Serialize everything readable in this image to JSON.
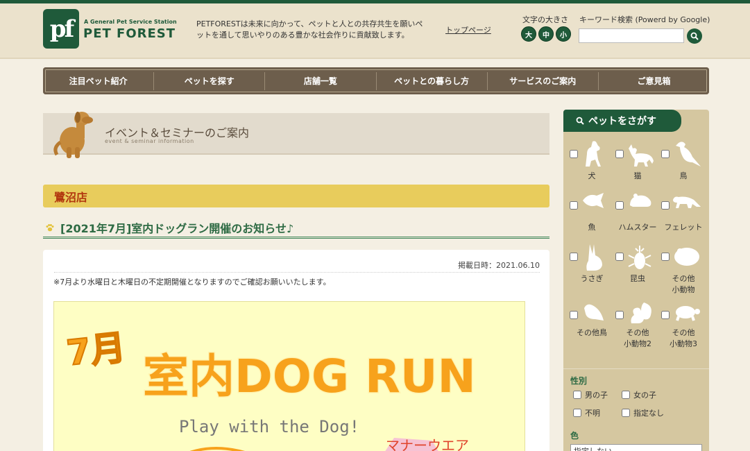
{
  "header": {
    "logo_mark": "pf",
    "logo_tagline": "A General Pet Service Station",
    "logo_name": "PET FOREST",
    "tagline": "PETFORESTは未来に向かって、ペットと人との共存共生を願いペットを通して思いやりのある豊かな社会作りに貢献致します。",
    "top_link": "トップページ",
    "font_size_label": "文字の大きさ",
    "font_sizes": [
      "大",
      "中",
      "小"
    ],
    "search_label": "キーワード検索 (Powerd by Google)",
    "search_value": ""
  },
  "nav": {
    "items": [
      "注目ペット紹介",
      "ペットを探す",
      "店舗一覧",
      "ペットとの暮らし方",
      "サービスのご案内",
      "ご意見箱"
    ]
  },
  "page": {
    "heading": "イベント＆セミナーのご案内",
    "heading_sub": "event & seminar information",
    "store": "鷺沼店",
    "article_title": "[2021年7月]室内ドッグラン開催のお知らせ♪",
    "posted": "掲載日時：2021.06.10",
    "note": "※7月より水曜日と木曜日の不定期開催となりますのでご確認お願いいたします。",
    "banner": {
      "month": "7月",
      "headline": "室内DOG RUN",
      "sub": "Play with the Dog!",
      "corner": "マナーウエア"
    }
  },
  "sidebar": {
    "title": "ペットをさがす",
    "pets": [
      {
        "label": "犬",
        "icon": "dog-icon"
      },
      {
        "label": "猫",
        "icon": "cat-icon"
      },
      {
        "label": "鳥",
        "icon": "bird-icon"
      },
      {
        "label": "魚",
        "icon": "fish-icon"
      },
      {
        "label": "ハムスター",
        "icon": "hamster-icon"
      },
      {
        "label": "フェレット",
        "icon": "ferret-icon"
      },
      {
        "label": "うさぎ",
        "icon": "rabbit-icon"
      },
      {
        "label": "昆虫",
        "icon": "beetle-icon"
      },
      {
        "label": "その他\n小動物",
        "icon": "small-animal-icon"
      },
      {
        "label": "その他鳥",
        "icon": "other-bird-icon"
      },
      {
        "label": "その他\n小動物2",
        "icon": "squirrel-icon"
      },
      {
        "label": "その他\n小動物3",
        "icon": "turtle-icon"
      }
    ],
    "gender_label": "性別",
    "genders": [
      "男の子",
      "女の子",
      "不明",
      "指定なし"
    ],
    "color_label": "色",
    "color_value": "指定しない"
  },
  "colors": {
    "brand_green": "#1f5a3a",
    "nav_brown": "#6d5e4c",
    "store_yellow": "#e8cc5c",
    "store_red": "#b2380f"
  }
}
